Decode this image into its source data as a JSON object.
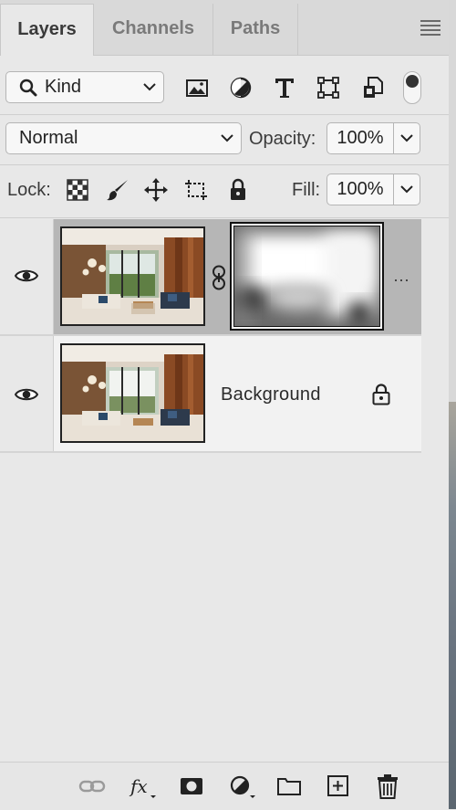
{
  "tabs": [
    {
      "label": "Layers",
      "active": true
    },
    {
      "label": "Channels",
      "active": false
    },
    {
      "label": "Paths",
      "active": false
    }
  ],
  "filter": {
    "kind_label": "Kind",
    "icons": [
      "image-filter-icon",
      "adjustment-filter-icon",
      "type-filter-icon",
      "shape-filter-icon",
      "smart-object-filter-icon"
    ],
    "filter_toggle_on": true
  },
  "blend": {
    "mode": "Normal",
    "opacity_label": "Opacity:",
    "opacity_value": "100%",
    "lock_label": "Lock:",
    "fill_label": "Fill:",
    "fill_value": "100%",
    "lock_icons": [
      "lock-transparent-pixels-icon",
      "lock-image-pixels-icon",
      "lock-position-icon",
      "lock-artboard-icon",
      "lock-all-icon"
    ]
  },
  "layers": [
    {
      "name": "",
      "selected": true,
      "has_mask": true,
      "more_label": "···"
    },
    {
      "name": "Background",
      "selected": false,
      "has_mask": false,
      "locked": true
    }
  ],
  "bottom_bar": [
    "link-layers-icon",
    "fx-icon",
    "add-mask-icon",
    "new-fill-adjustment-icon",
    "new-group-icon",
    "new-layer-icon",
    "delete-layer-icon"
  ],
  "colors": {
    "panel_bg": "#e8e8e8",
    "selected_row": "#b6b6b6",
    "tab_bar": "#d9d9d9"
  }
}
